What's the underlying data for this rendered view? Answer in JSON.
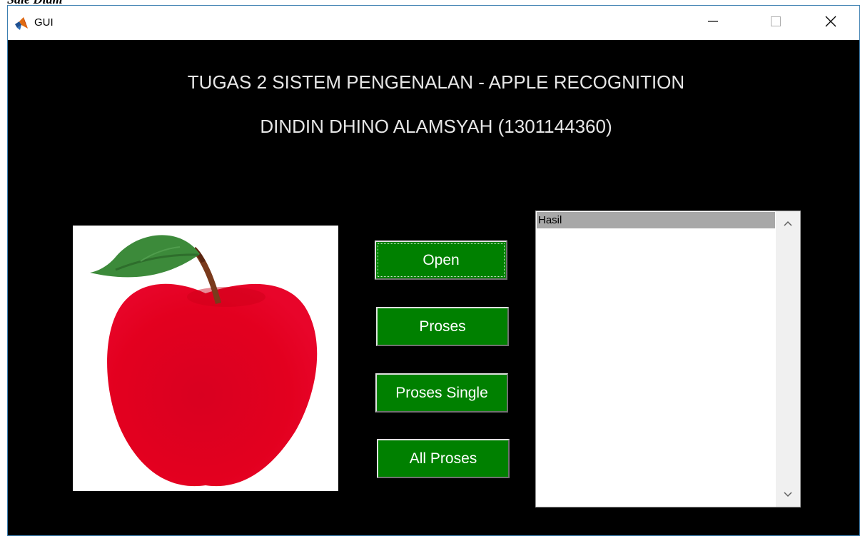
{
  "page_caption": "Sale Diam",
  "window": {
    "title": "GUI",
    "icon": "matlab-icon",
    "controls": {
      "minimize_icon": "minimize-icon",
      "maximize_icon": "maximize-icon",
      "close_icon": "close-icon"
    }
  },
  "header": {
    "line1": "TUGAS 2 SISTEM PENGENALAN - APPLE RECOGNITION",
    "line2": "DINDIN DHINO ALAMSYAH (1301144360)"
  },
  "image_panel": {
    "content": "red-apple-image",
    "colors": {
      "apple": "#e3001f",
      "leaf": "#3c8a3a",
      "stem": "#7a3a1c"
    }
  },
  "buttons": {
    "open": "Open",
    "proses": "Proses",
    "proses_single": "Proses Single",
    "all_proses": "All Proses",
    "color": "#008000"
  },
  "result_list": {
    "items": [
      "Hasil"
    ],
    "selected_index": 0
  }
}
